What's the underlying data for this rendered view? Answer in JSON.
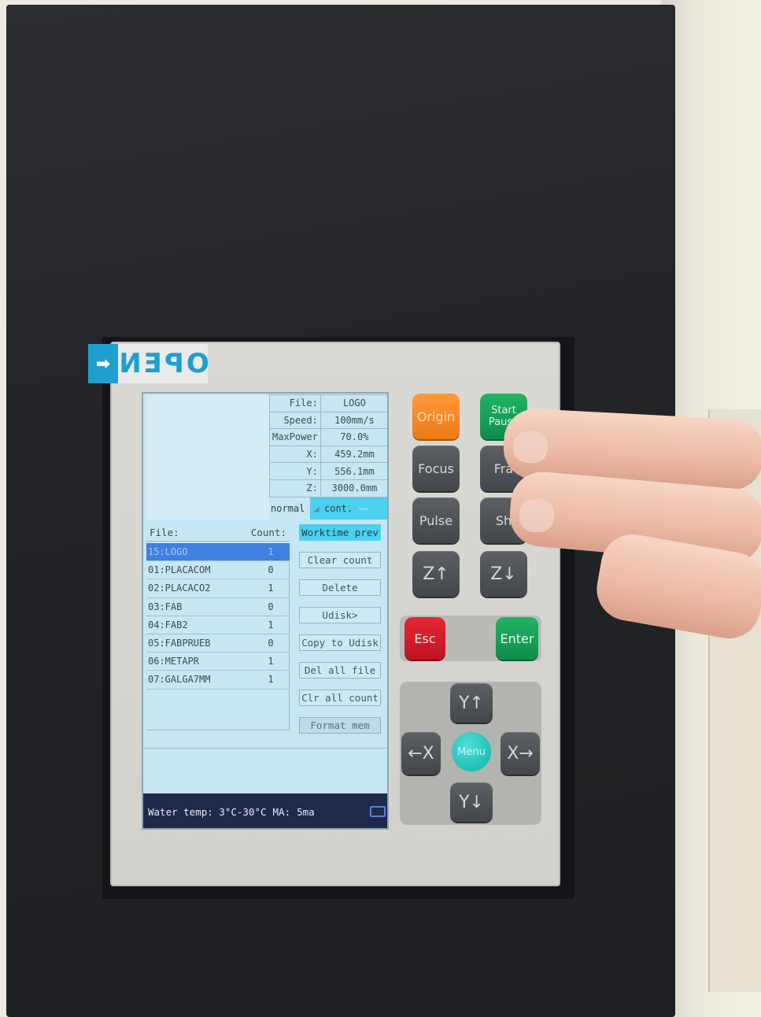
{
  "sticker": {
    "arrow": "➡",
    "text": "OPEN"
  },
  "lcd": {
    "info": [
      {
        "key": "File:",
        "value": "LOGO"
      },
      {
        "key": "Speed:",
        "value": "100mm/s"
      },
      {
        "key": "MaxPower",
        "value": "70.0%"
      },
      {
        "key": "X:",
        "value": "459.2mm"
      },
      {
        "key": "Y:",
        "value": "556.1mm"
      },
      {
        "key": "Z:",
        "value": "3000.0mm"
      }
    ],
    "mode": {
      "left": "normal",
      "right": "cont."
    },
    "file_header": {
      "file": "File:",
      "count": "Count:"
    },
    "files": [
      {
        "name": "15:LOGO",
        "count": "1"
      },
      {
        "name": "01:PLACACOM",
        "count": "0"
      },
      {
        "name": "02:PLACACO2",
        "count": "1"
      },
      {
        "name": "03:FAB",
        "count": "0"
      },
      {
        "name": "04:FAB2",
        "count": "1"
      },
      {
        "name": "05:FABPRUEB",
        "count": "0"
      },
      {
        "name": "06:METAPR",
        "count": "1"
      },
      {
        "name": "07:GALGA7MM",
        "count": "1"
      }
    ],
    "menu": [
      "Worktime prev",
      "Clear count",
      "Delete",
      "Udisk>",
      "Copy to Udisk",
      "Del all file",
      "Clr all count",
      "Format mem"
    ],
    "status": {
      "water": "Water temp: 3°C-30°C",
      "ma_label": "MA:",
      "ma_value": "5ma"
    }
  },
  "keys": {
    "origin": "Origin",
    "start": "Start",
    "pause": "Pause",
    "focus": "Focus",
    "frame": "Fra",
    "pulse": "Pulse",
    "shift": "Sh",
    "z_up": "Z↑",
    "z_down": "Z↓",
    "esc": "Esc",
    "enter": "Enter",
    "y_up": "Y↑",
    "y_down": "Y↓",
    "x_left": "←X",
    "x_right": "X→",
    "menu": "Menu"
  },
  "colors": {
    "lcd_bg": "#c6e6f3",
    "highlight": "#4cd0ee",
    "selected_row": "#3f7fe0",
    "origin_key": "#ec7a15",
    "start_key": "#0f8d4b",
    "esc_key": "#bf1421",
    "menu_key": "#1fbfb6",
    "sticker_blue": "#1e9fd0"
  }
}
